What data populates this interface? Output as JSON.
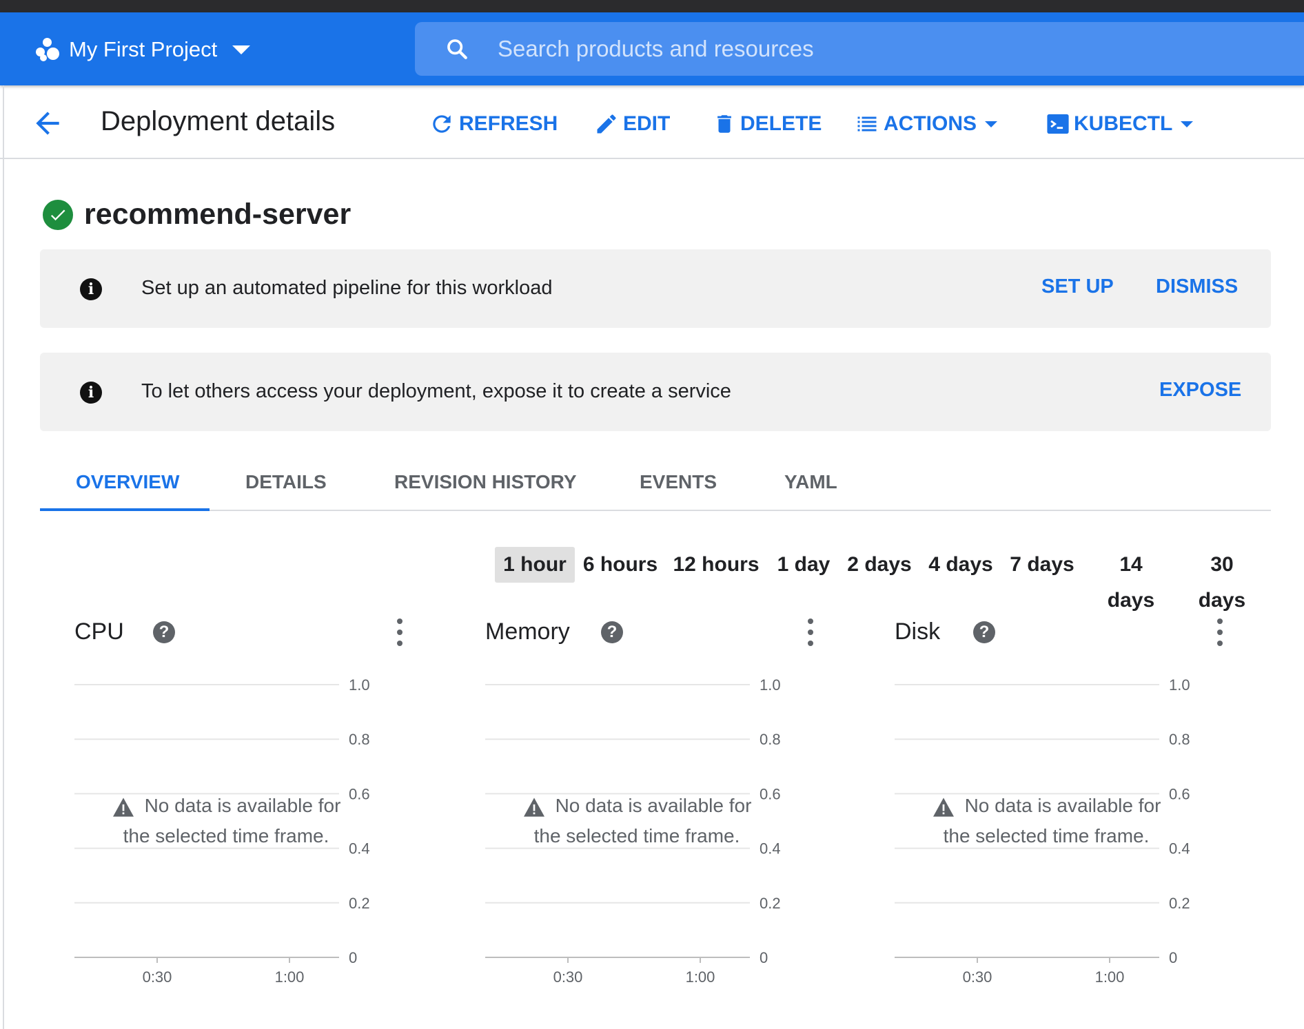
{
  "appbar": {
    "project_name": "My First Project",
    "search_placeholder": "Search products and resources"
  },
  "toolbar": {
    "title": "Deployment details",
    "refresh": "REFRESH",
    "edit": "EDIT",
    "delete": "DELETE",
    "actions": "ACTIONS",
    "kubectl": "KUBECTL"
  },
  "resource": {
    "name": "recommend-server",
    "status": "ok"
  },
  "banners": [
    {
      "message": "Set up an automated pipeline for this workload",
      "actions": [
        "SET UP",
        "DISMISS"
      ]
    },
    {
      "message": "To let others access your deployment, expose it to create a service",
      "actions": [
        "EXPOSE"
      ]
    }
  ],
  "tabs": [
    "OVERVIEW",
    "DETAILS",
    "REVISION HISTORY",
    "EVENTS",
    "YAML"
  ],
  "active_tab": "OVERVIEW",
  "time_ranges": [
    "1 hour",
    "6 hours",
    "12 hours",
    "1 day",
    "2 days",
    "4 days",
    "7 days",
    "14 days",
    "30 days"
  ],
  "selected_range": "1 hour",
  "charts": {
    "no_data_line1": "No data is available for",
    "no_data_line2": "the selected time frame."
  },
  "chart_data": [
    {
      "type": "line",
      "title": "CPU",
      "series": [],
      "y_ticks": [
        "1.0",
        "0.8",
        "0.6",
        "0.4",
        "0.2",
        "0"
      ],
      "x_ticks": [
        "0:30",
        "1:00"
      ],
      "ylim": [
        0,
        1.0
      ],
      "grid": true
    },
    {
      "type": "line",
      "title": "Memory",
      "series": [],
      "y_ticks": [
        "1.0",
        "0.8",
        "0.6",
        "0.4",
        "0.2",
        "0"
      ],
      "x_ticks": [
        "0:30",
        "1:00"
      ],
      "ylim": [
        0,
        1.0
      ],
      "grid": true
    },
    {
      "type": "line",
      "title": "Disk",
      "series": [],
      "y_ticks": [
        "1.0",
        "0.8",
        "0.6",
        "0.4",
        "0.2",
        "0"
      ],
      "x_ticks": [
        "0:30",
        "1:00"
      ],
      "ylim": [
        0,
        1.0
      ],
      "grid": true
    }
  ],
  "colors": {
    "primary": "#1a73e8",
    "success": "#1e8e3e",
    "banner_bg": "#f1f1f1"
  },
  "icons": [
    "hexagon-dots-icon",
    "search-icon",
    "arrow-back-icon",
    "refresh-icon",
    "pencil-icon",
    "trash-icon",
    "list-icon",
    "terminal-icon",
    "check-circle-icon",
    "info-icon",
    "help-icon",
    "more-vert-icon",
    "warning-icon"
  ]
}
